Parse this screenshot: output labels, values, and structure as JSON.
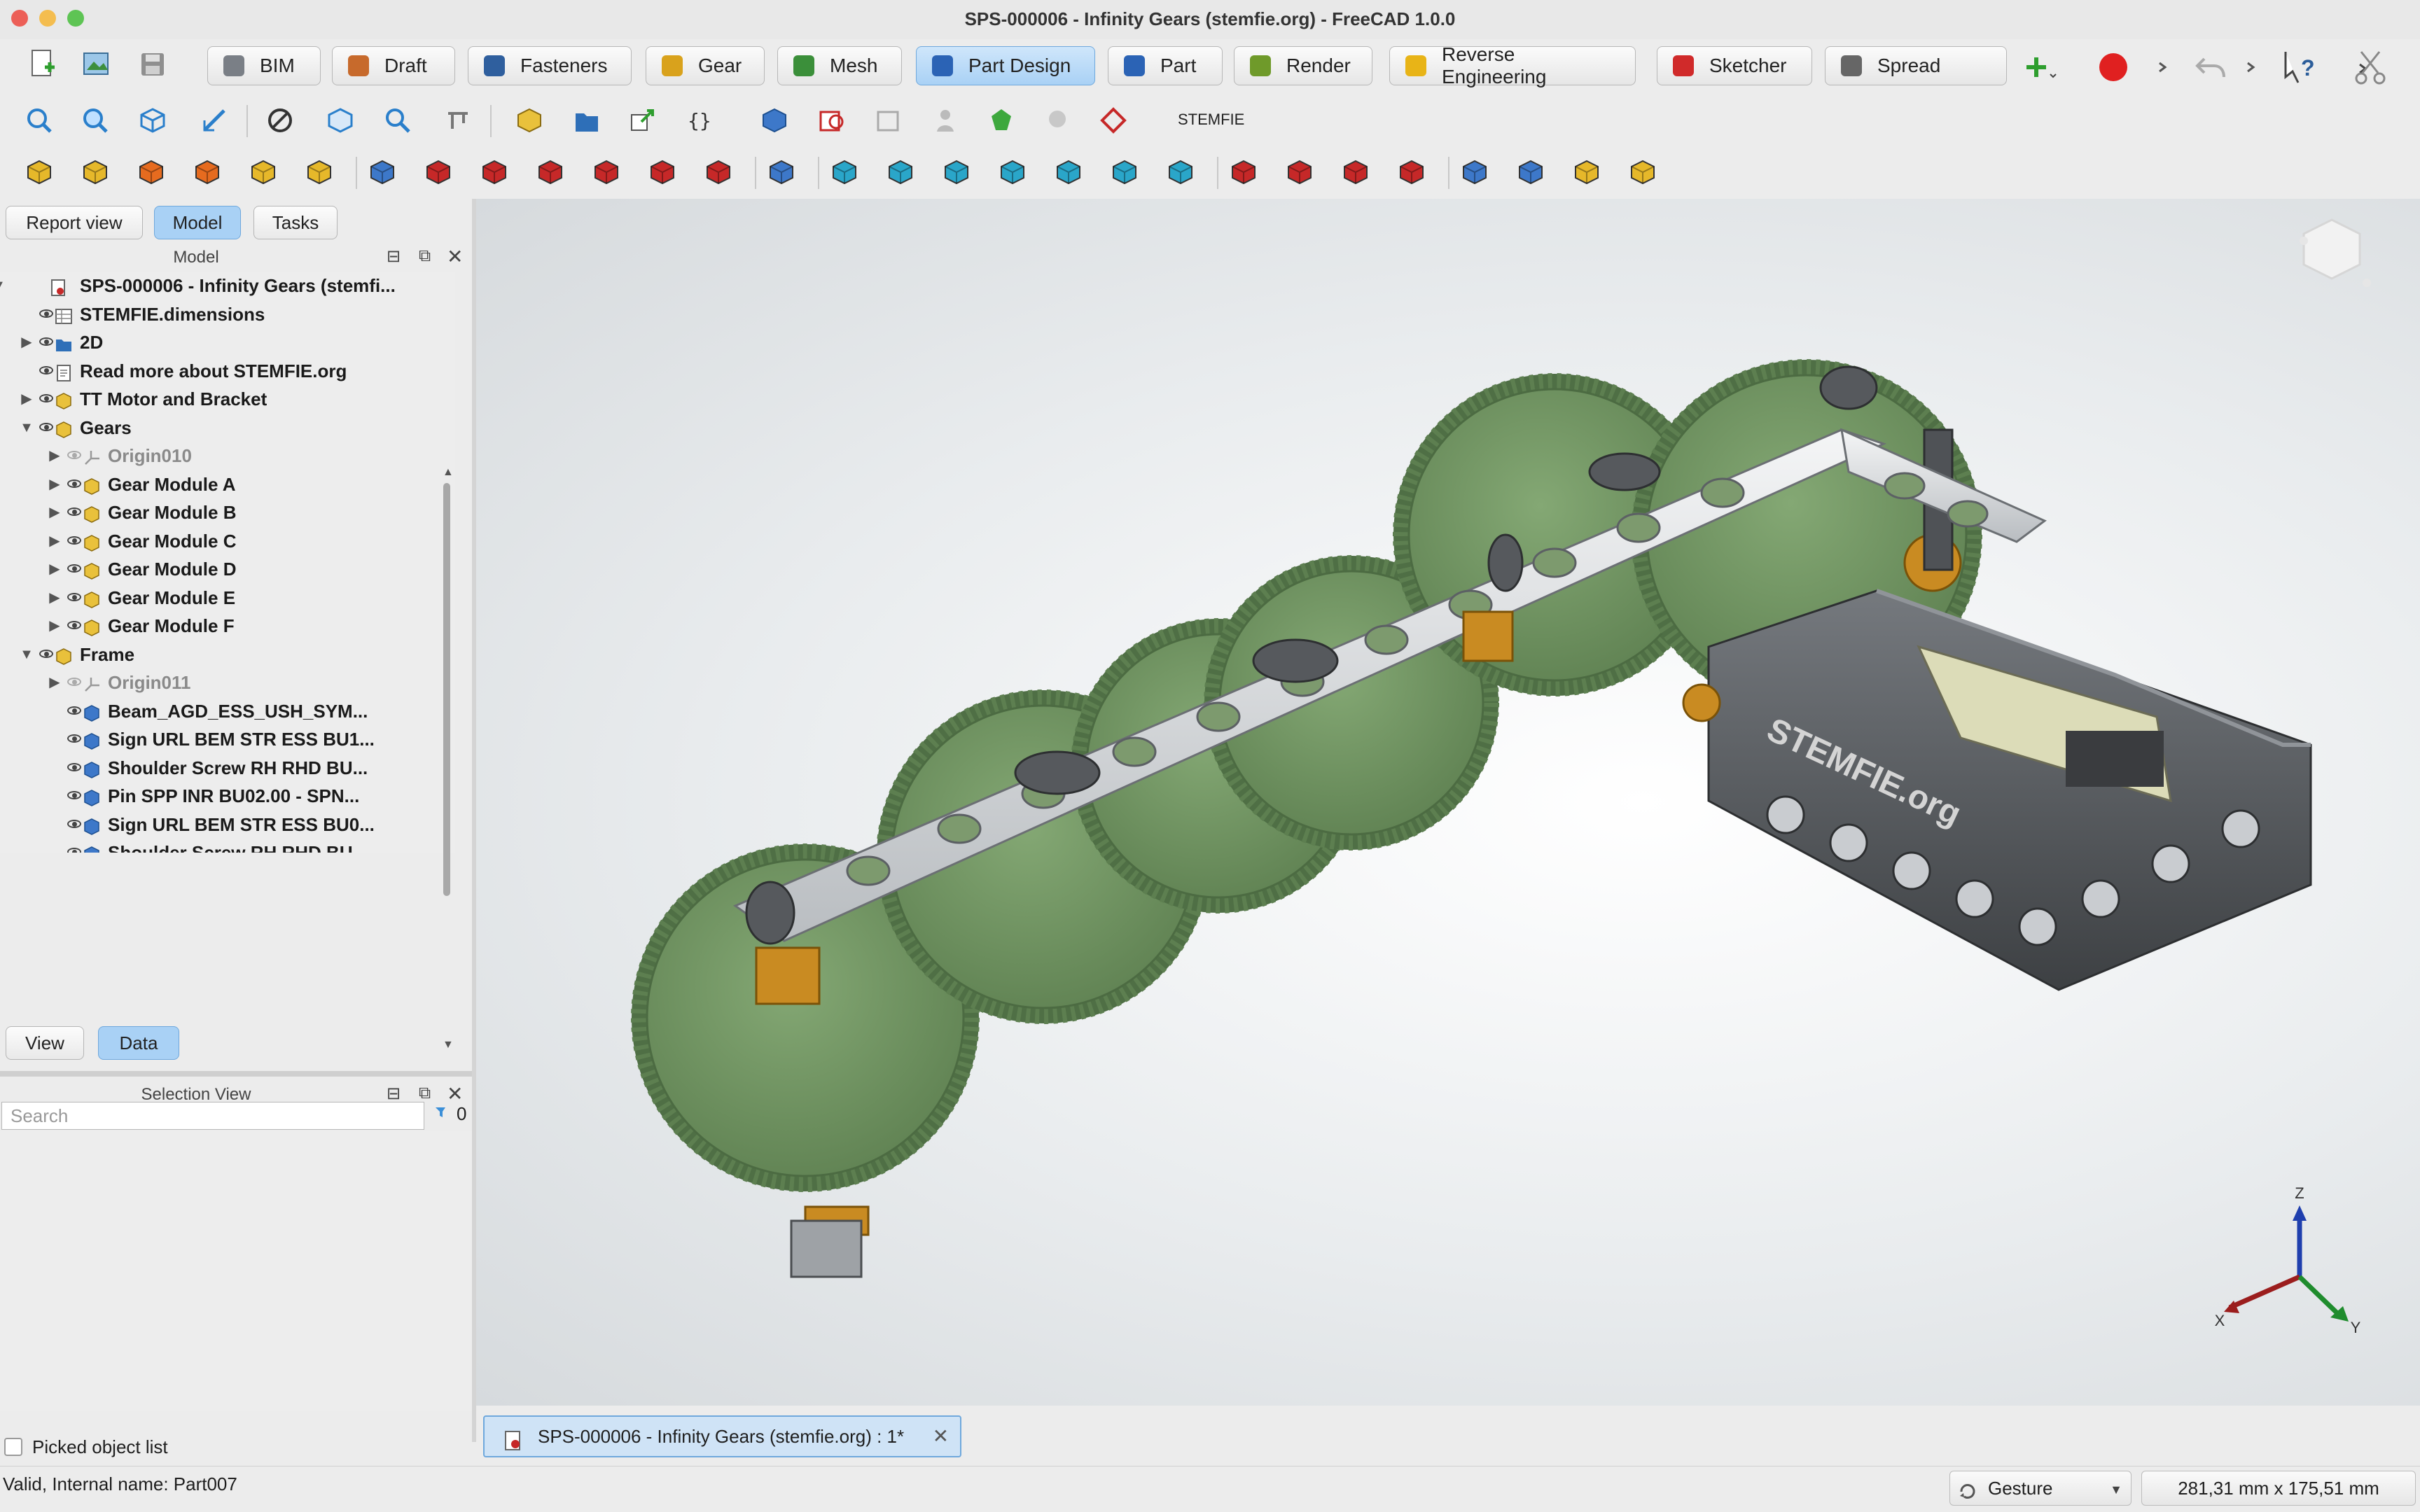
{
  "window": {
    "title": "SPS-000006 - Infinity Gears (stemfie.org) - FreeCAD 1.0.0"
  },
  "workbenches": [
    {
      "label": "BIM",
      "icon": "bim-icon",
      "color": "#7a7f86",
      "active": false
    },
    {
      "label": "Draft",
      "icon": "draft-icon",
      "color": "#c76a2c",
      "active": false
    },
    {
      "label": "Fasteners",
      "icon": "fasteners-icon",
      "color": "#2f5f9e",
      "active": false
    },
    {
      "label": "Gear",
      "icon": "gear-icon",
      "color": "#d9a21c",
      "active": false
    },
    {
      "label": "Mesh",
      "icon": "mesh-icon",
      "color": "#3b8f3a",
      "active": false
    },
    {
      "label": "Part Design",
      "icon": "part-design-icon",
      "color": "#2b63b5",
      "active": true
    },
    {
      "label": "Part",
      "icon": "part-icon",
      "color": "#2b63b5",
      "active": false
    },
    {
      "label": "Render",
      "icon": "render-icon",
      "color": "#6f9a2a",
      "active": false
    },
    {
      "label": "Reverse Engineering",
      "icon": "reverse-engineering-icon",
      "color": "#e8b417",
      "active": false
    },
    {
      "label": "Sketcher",
      "icon": "sketcher-icon",
      "color": "#d02a2a",
      "active": false
    },
    {
      "label": "Spread",
      "icon": "spreadsheet-icon",
      "color": "#666666",
      "active": false
    }
  ],
  "toolbar2": {
    "stemfie_label": "STEMFIE"
  },
  "left_panel": {
    "tabs": [
      {
        "label": "Report view",
        "active": false
      },
      {
        "label": "Model",
        "active": true
      },
      {
        "label": "Tasks",
        "active": false
      }
    ],
    "model_header": "Model",
    "tree": [
      {
        "label": "SPS-000006 - Infinity Gears (stemfi...",
        "depth": 0,
        "arrow": "open",
        "icon": "document-icon",
        "visible": null,
        "dim": false
      },
      {
        "label": "STEMFIE.dimensions",
        "depth": 1,
        "arrow": "none",
        "icon": "spreadsheet-icon",
        "visible": true,
        "dim": false
      },
      {
        "label": "2D",
        "depth": 1,
        "arrow": "closed",
        "icon": "folder-icon",
        "visible": true,
        "dim": false
      },
      {
        "label": "Read more about STEMFIE.org",
        "depth": 1,
        "arrow": "none",
        "icon": "text-document-icon",
        "visible": true,
        "dim": false
      },
      {
        "label": "TT Motor and Bracket",
        "depth": 1,
        "arrow": "closed",
        "icon": "part-container-icon",
        "visible": true,
        "dim": false
      },
      {
        "label": "Gears",
        "depth": 1,
        "arrow": "open",
        "icon": "part-container-icon",
        "visible": true,
        "dim": false
      },
      {
        "label": "Origin010",
        "depth": 2,
        "arrow": "closed",
        "icon": "origin-icon",
        "visible": false,
        "dim": true
      },
      {
        "label": "Gear Module A",
        "depth": 2,
        "arrow": "closed",
        "icon": "part-container-icon",
        "visible": true,
        "dim": false
      },
      {
        "label": "Gear Module B",
        "depth": 2,
        "arrow": "closed",
        "icon": "part-container-icon",
        "visible": true,
        "dim": false
      },
      {
        "label": "Gear Module C",
        "depth": 2,
        "arrow": "closed",
        "icon": "part-container-icon",
        "visible": true,
        "dim": false
      },
      {
        "label": "Gear Module D",
        "depth": 2,
        "arrow": "closed",
        "icon": "part-container-icon",
        "visible": true,
        "dim": false
      },
      {
        "label": "Gear Module E",
        "depth": 2,
        "arrow": "closed",
        "icon": "part-container-icon",
        "visible": true,
        "dim": false
      },
      {
        "label": "Gear Module F",
        "depth": 2,
        "arrow": "closed",
        "icon": "part-container-icon",
        "visible": true,
        "dim": false
      },
      {
        "label": "Frame",
        "depth": 1,
        "arrow": "open",
        "icon": "part-container-icon",
        "visible": true,
        "dim": false
      },
      {
        "label": "Origin011",
        "depth": 2,
        "arrow": "closed",
        "icon": "origin-icon",
        "visible": false,
        "dim": true
      },
      {
        "label": "Beam_AGD_ESS_USH_SYM...",
        "depth": 2,
        "arrow": "none",
        "icon": "solid-icon",
        "visible": true,
        "dim": false
      },
      {
        "label": "Sign URL BEM STR ESS BU1...",
        "depth": 2,
        "arrow": "none",
        "icon": "solid-icon",
        "visible": true,
        "dim": false
      },
      {
        "label": "Shoulder Screw RH RHD BU...",
        "depth": 2,
        "arrow": "none",
        "icon": "solid-icon",
        "visible": true,
        "dim": false
      },
      {
        "label": "Pin SPP INR BU02.00 - SPN...",
        "depth": 2,
        "arrow": "none",
        "icon": "solid-icon",
        "visible": true,
        "dim": false
      },
      {
        "label": "Sign URL BEM STR ESS BU0...",
        "depth": 2,
        "arrow": "none",
        "icon": "solid-icon",
        "visible": true,
        "dim": false
      },
      {
        "label": "Shoulder Screw RH RHD BU...",
        "depth": 2,
        "arrow": "none",
        "icon": "solid-icon",
        "visible": true,
        "dim": false
      }
    ],
    "bottom_tabs": [
      {
        "label": "View",
        "active": false
      },
      {
        "label": "Data",
        "active": true
      }
    ],
    "selection_view": {
      "header": "Selection View",
      "search_placeholder": "Search",
      "count": "0",
      "picked_list_label": "Picked object list"
    }
  },
  "document_tab": {
    "label": "SPS-000006 - Infinity Gears (stemfie.org) : 1*"
  },
  "status_bar": {
    "message": "Valid, Internal name: Part007",
    "navigation_style": "Gesture",
    "dimensions": "281,31 mm x 175,51 mm"
  },
  "viewport": {
    "axis_labels": {
      "x": "X",
      "y": "Y",
      "z": "Z"
    },
    "model_label": "STEMFIE.org",
    "colors": {
      "gear": "#6e9460",
      "beam": "#cfd2d5",
      "frame": "#5a5d61",
      "brass": "#c98b22"
    }
  }
}
